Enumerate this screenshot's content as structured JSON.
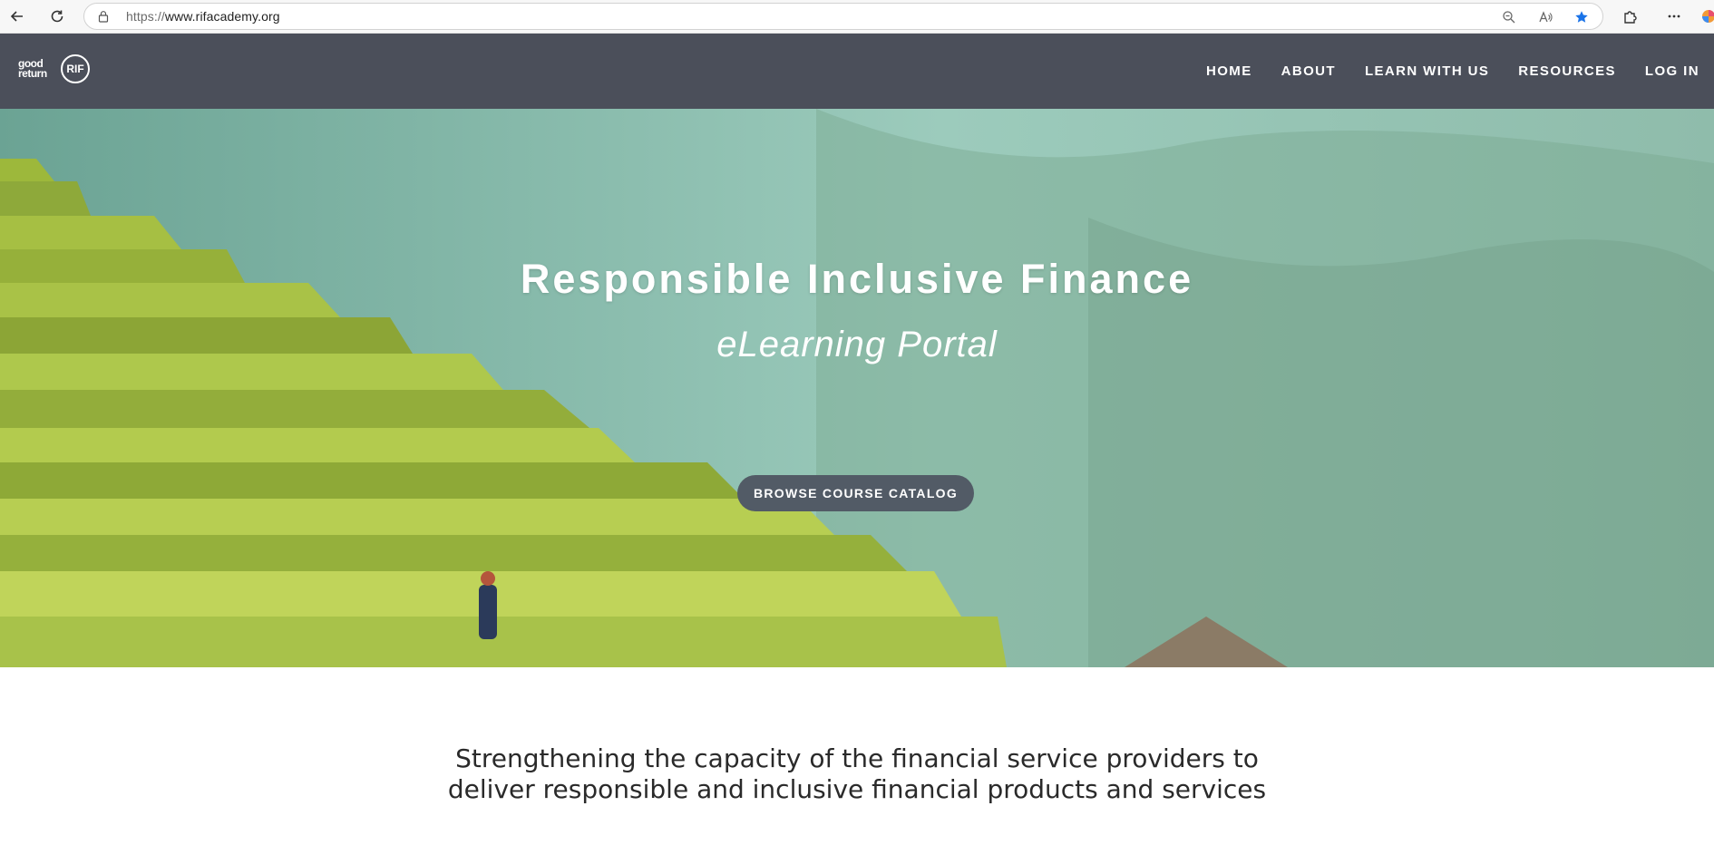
{
  "browser": {
    "url_protocol": "https://",
    "url_host": "www.rifacademy.org"
  },
  "header": {
    "logo_good_line1": "good",
    "logo_good_line2": "return",
    "logo_rif": "RIF",
    "nav": [
      {
        "label": "HOME"
      },
      {
        "label": "ABOUT"
      },
      {
        "label": "LEARN WITH US"
      },
      {
        "label": "RESOURCES"
      },
      {
        "label": "LOG IN"
      }
    ]
  },
  "hero": {
    "title": "Responsible Inclusive Finance",
    "subtitle": "eLearning Portal",
    "cta_label": "BROWSE COURSE CATALOG"
  },
  "tagline": {
    "line1": "Strengthening the capacity of the financial service providers to",
    "line2": "deliver responsible and inclusive financial products and services"
  },
  "colors": {
    "header_bg": "#4b4f5a",
    "cta_bg": "#525b66",
    "favorite_star": "#1a73e8"
  }
}
